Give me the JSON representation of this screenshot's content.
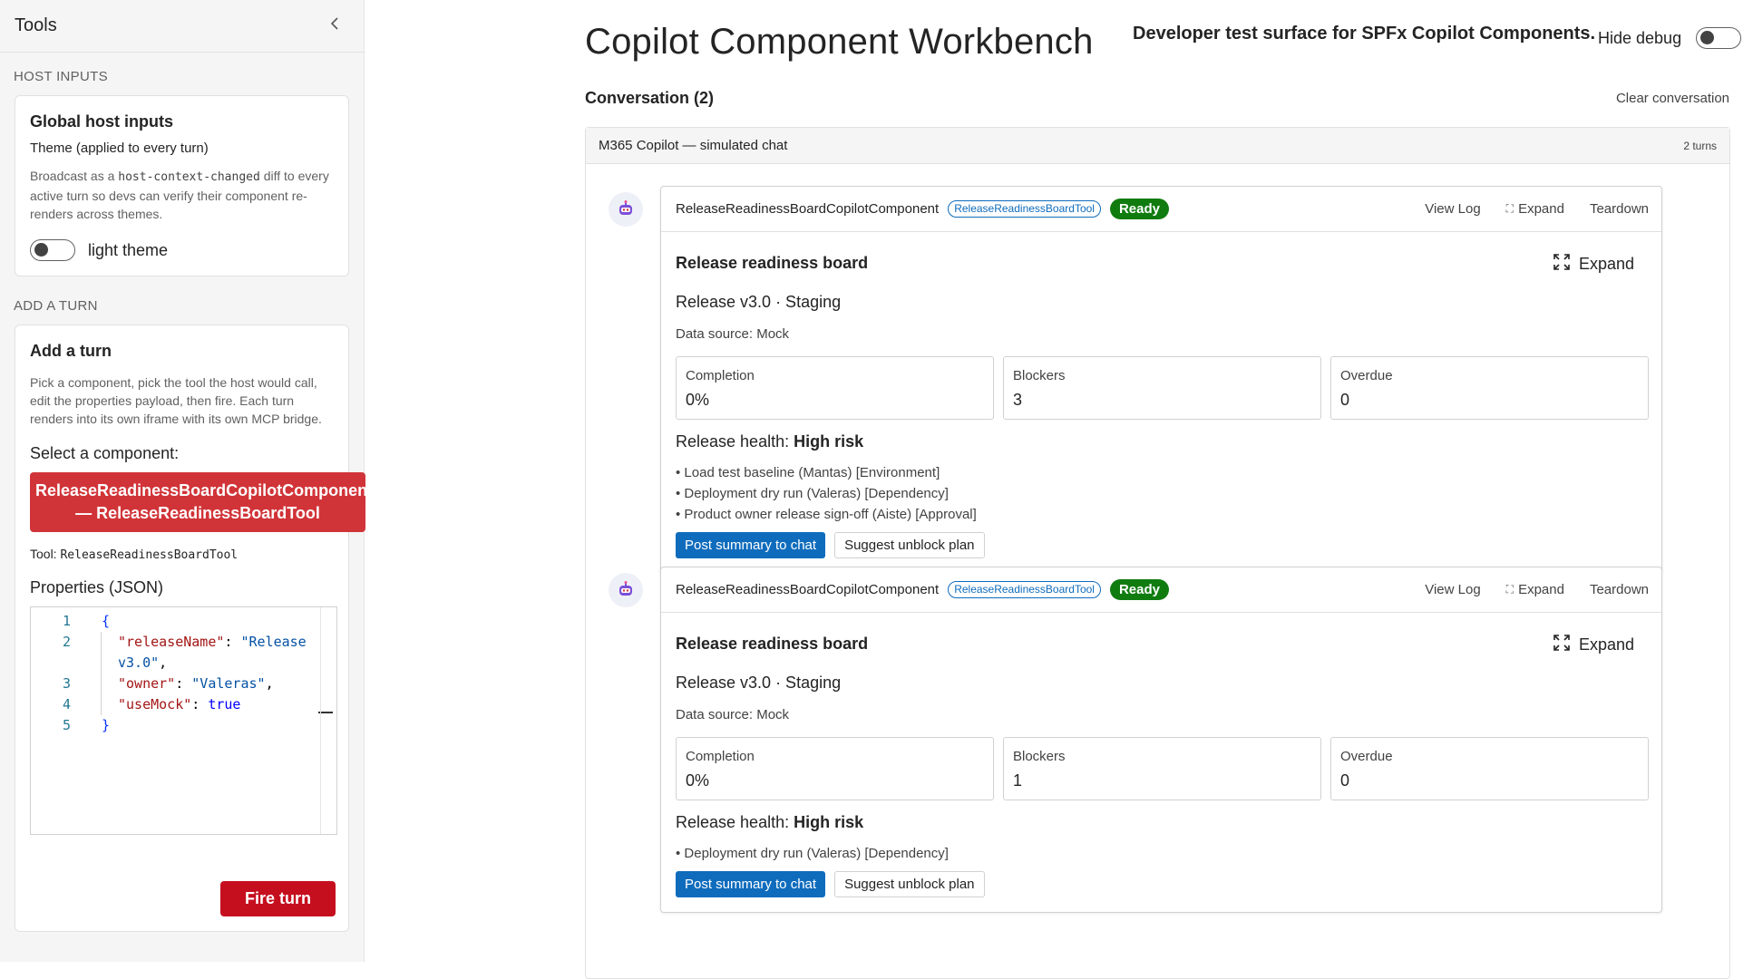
{
  "sidebar": {
    "title": "Tools",
    "host_inputs_section": "HOST INPUTS",
    "host_card": {
      "title": "Global host inputs",
      "subtitle": "Theme (applied to every turn)",
      "desc_pre": "Broadcast as a ",
      "desc_code": "host-context-changed",
      "desc_post": " diff to every active turn so devs can verify their component re-renders across themes.",
      "theme_toggle_label": "light theme",
      "theme_toggle_on": false
    },
    "add_turn_section": "ADD A TURN",
    "add_turn_card": {
      "title": "Add a turn",
      "desc": "Pick a component, pick the tool the host would call, edit the properties payload, then fire. Each turn renders into its own iframe with its own MCP bridge.",
      "select_label": "Select a component:",
      "selected_line1": "ReleaseReadinessBoardCopilotComponent",
      "selected_line2": "— ReleaseReadinessBoardTool",
      "tool_prefix": "Tool: ",
      "tool_name": "ReleaseReadinessBoardTool",
      "props_label": "Properties (JSON)",
      "editor": {
        "line_numbers": [
          "1",
          "2",
          "",
          "3",
          "4",
          "5"
        ],
        "open_brace": "{",
        "k1": "\"releaseName\"",
        "v1a": "\"Release",
        "v1b": "v3.0\"",
        "k2": "\"owner\"",
        "v2": "\"Valeras\"",
        "k3": "\"useMock\"",
        "v3": "true",
        "close_brace": "}"
      },
      "fire_label": "Fire turn"
    }
  },
  "main": {
    "title": "Copilot Component Workbench",
    "subtitle": "Developer test surface for SPFx Copilot Components.",
    "hide_debug_label": "Hide debug",
    "hide_debug_on": false,
    "conversation_title": "Conversation (2)",
    "clear_label": "Clear conversation",
    "chat_header_title": "M365 Copilot — simulated chat",
    "chat_header_turns": "2 turns",
    "turns": [
      {
        "component": "ReleaseReadinessBoardCopilotComponent",
        "tool": "ReleaseReadinessBoardTool",
        "status": "Ready",
        "view_log": "View Log",
        "expand": "Expand",
        "teardown": "Teardown",
        "board_title": "Release readiness board",
        "board_expand": "Expand",
        "release": "Release v3.0 · Staging",
        "source": "Data source: Mock",
        "metrics": [
          {
            "label": "Completion",
            "value": "0%"
          },
          {
            "label": "Blockers",
            "value": "3"
          },
          {
            "label": "Overdue",
            "value": "0"
          }
        ],
        "health_label": "Release health: ",
        "health_value": "High risk",
        "blockers": [
          "• Load test baseline (Mantas) [Environment]",
          "• Deployment dry run (Valeras) [Dependency]",
          "• Product owner release sign-off (Aiste) [Approval]"
        ],
        "primary_action": "Post summary to chat",
        "secondary_action": "Suggest unblock plan"
      },
      {
        "component": "ReleaseReadinessBoardCopilotComponent",
        "tool": "ReleaseReadinessBoardTool",
        "status": "Ready",
        "view_log": "View Log",
        "expand": "Expand",
        "teardown": "Teardown",
        "board_title": "Release readiness board",
        "board_expand": "Expand",
        "release": "Release v3.0 · Staging",
        "source": "Data source: Mock",
        "metrics": [
          {
            "label": "Completion",
            "value": "0%"
          },
          {
            "label": "Blockers",
            "value": "1"
          },
          {
            "label": "Overdue",
            "value": "0"
          }
        ],
        "health_label": "Release health: ",
        "health_value": "High risk",
        "blockers": [
          "• Deployment dry run (Valeras) [Dependency]"
        ],
        "primary_action": "Post summary to chat",
        "secondary_action": "Suggest unblock plan"
      }
    ]
  },
  "colors": {
    "accent": "#0f6cbd",
    "danger": "#d13438",
    "success": "#107c10"
  },
  "icons": [
    "chevron-left-icon",
    "copilot-bot-icon",
    "expand-dashed-icon",
    "expand-arrows-icon"
  ]
}
